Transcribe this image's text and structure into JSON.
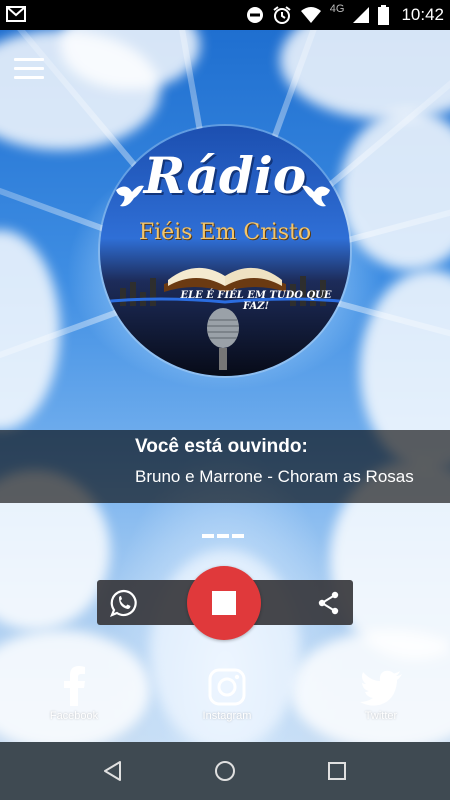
{
  "status_bar": {
    "time": "10:42",
    "network": "4G",
    "icons": [
      "mail-icon",
      "do-not-disturb-icon",
      "alarm-icon",
      "wifi-icon",
      "signal-icon",
      "battery-icon"
    ]
  },
  "app": {
    "menu_icon": "hamburger-menu-icon",
    "logo": {
      "title": "Rádio",
      "subtitle": "Fiéis Em Cristo",
      "tagline": "ELE É FIÉL EM TUDO QUE FAZ!"
    },
    "now_playing": {
      "label": "Você está ouvindo:",
      "track": "Bruno e Marrone - Choram as Rosas"
    },
    "controls": {
      "whatsapp_icon": "whatsapp-icon",
      "stop_icon": "stop-icon",
      "share_icon": "share-icon",
      "stop_color": "#e0393b"
    },
    "social": [
      {
        "name": "Facebook",
        "icon": "facebook-icon"
      },
      {
        "name": "Instagram",
        "icon": "instagram-icon"
      },
      {
        "name": "Twitter",
        "icon": "twitter-icon"
      }
    ]
  },
  "nav_bar": {
    "icons": [
      "back-icon",
      "home-icon",
      "recents-icon"
    ]
  }
}
